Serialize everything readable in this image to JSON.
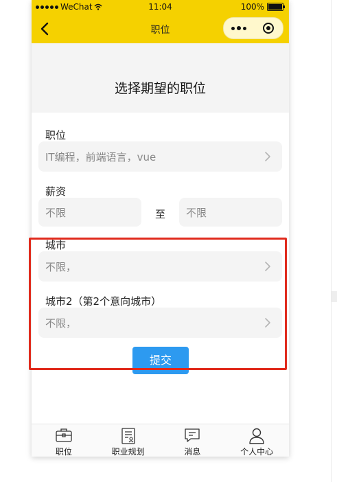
{
  "status_bar": {
    "carrier": "WeChat",
    "time": "11:04",
    "battery": "100%"
  },
  "nav": {
    "title": "职位"
  },
  "page": {
    "heading": "选择期望的职位"
  },
  "form": {
    "position": {
      "label": "职位",
      "value": "IT编程，前端语言，vue"
    },
    "salary": {
      "label": "薪资",
      "min": "不限",
      "separator": "至",
      "max": "不限"
    },
    "city": {
      "label": "城市",
      "value": "不限，"
    },
    "city2": {
      "label": "城市2（第2个意向城市）",
      "value": "不限，"
    },
    "submit_label": "提交"
  },
  "tabs": [
    {
      "label": "职位",
      "icon": "briefcase-icon"
    },
    {
      "label": "职业规划",
      "icon": "resume-icon"
    },
    {
      "label": "消息",
      "icon": "message-icon"
    },
    {
      "label": "个人中心",
      "icon": "person-icon"
    }
  ],
  "colors": {
    "brand_yellow": "#f5d100",
    "submit_blue": "#2d9af0",
    "annotation_red": "#e02a1c",
    "field_bg": "#f4f4f4"
  }
}
